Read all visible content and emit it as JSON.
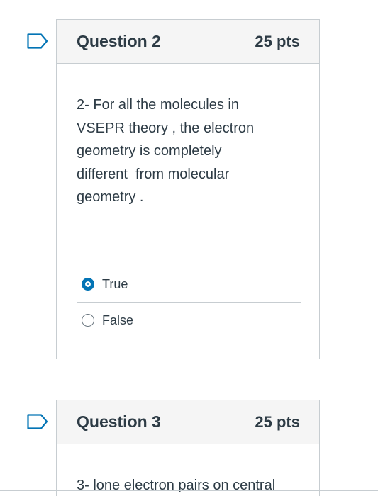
{
  "questions": [
    {
      "title": "Question 2",
      "points": "25 pts",
      "text": "2- For all the molecules in\nVSEPR theory , the electron\ngeometry is completely\ndifferent  from molecular\ngeometry .",
      "flag_icon": "bookmark-flag-icon",
      "answers": [
        {
          "label": "True",
          "selected": true
        },
        {
          "label": "False",
          "selected": false
        }
      ]
    },
    {
      "title": "Question 3",
      "points": "25 pts",
      "text": "3-  lone electron pairs on central",
      "flag_icon": "bookmark-flag-icon"
    }
  ],
  "colors": {
    "accent": "#0374b5",
    "text": "#2d3b45",
    "header_bg": "#f5f5f5",
    "border": "#c7cdd1"
  }
}
